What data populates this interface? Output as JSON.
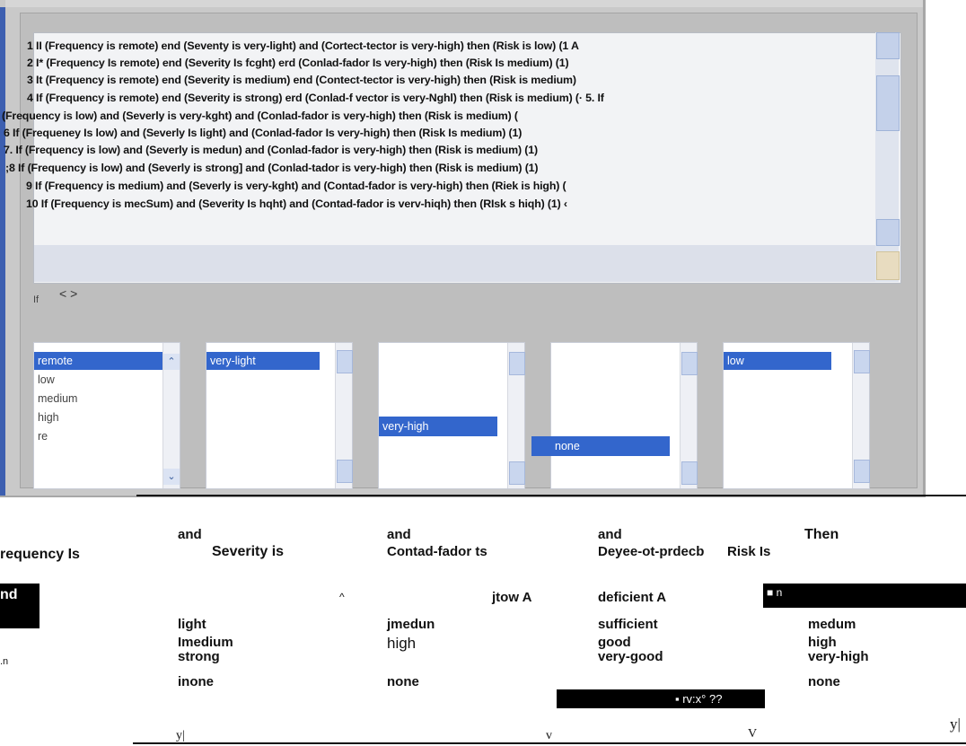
{
  "rules": [
    "1   II (Frequency is remote) end (Seventy is very-light) and (Cortect-tector is very-high) then (Risk is low) (1 A",
    "2    I* (Frequency Is remote) end (Severity Is fcght) erd (Conlad-fador Is very-high) then (Risk Is medium) (1)",
    "3    It (Frequency is remote) end (Severity is medium) end (Contect-tector is very-high) then (Risk is medium)",
    "4    If (Frequency is remote) end (Severity is strong) erd (Conlad-f vector is very-Nghl) then (Risk is medium) (· 5. If",
    "(Frequency is low) and (Severly is very-kght) and (Conlad-fador is very-high) then (Risk is medium) (",
    "6 If (Frequeney Is low) and (Severly Is light) and (Conlad-fador Is very-high) then (Risk Is medium) (1)",
    "7. If (Frequency is low) and (Severly is medun) and (Conlad-fador is very-high) then (Risk is medium) (1)",
    ";8 If (Frequency is low) and (Severly is strong] and (Conlad-tador is very-high) then (Risk is medium) (1)",
    "9    If (Frequency is medium) and (Severly is very-kght) and (Contad-fador is very-high) then (Riek is high) (",
    "10    If (Frequency is mecSum) and (Severity Is hqht) and (Contad-fador is verv-hiqh) then (RIsk  s hiqh) (1) ‹"
  ],
  "hscroll_glyphs": "< >",
  "if_label": "If",
  "listbox1": {
    "items": [
      "low",
      "medium",
      "high",
      "re"
    ],
    "selected": "remote"
  },
  "listbox2": {
    "selected": "very-light"
  },
  "listbox3": {
    "selected": "very-high"
  },
  "listbox4": {
    "selected": "none"
  },
  "listbox5": {
    "selected": "low"
  },
  "lower": {
    "frequency_header": "requency Is",
    "frequency_selected": "nd",
    "frequency_fragment": ".n",
    "and1": "and",
    "severity_header": "Severity is",
    "and2": "and",
    "contact_header": "Contad-fador ts",
    "and3": "and",
    "degree_header": "Deyee-ot-prdecb",
    "risk_header": "Risk Is",
    "then": "Then",
    "caret1": "^",
    "severity_items": [
      "light",
      "Imedium",
      "strong",
      "inone"
    ],
    "contact_items": [
      "jtow A",
      "jmedun",
      "high",
      "none"
    ],
    "degree_items": [
      "deficient A",
      "sufficient",
      "good",
      "very-good"
    ],
    "degree_selected": "▪ rv:x°  ??",
    "risk_selected": "■  n",
    "risk_items": [
      "medum",
      "high",
      "very-high",
      "none"
    ],
    "bottom_marks": [
      "y|",
      "v",
      "V",
      "y|"
    ]
  },
  "colors": {
    "selection_blue": "#3366cc",
    "window_gray": "#c9c9c9",
    "accent": "#3d5fb0"
  }
}
